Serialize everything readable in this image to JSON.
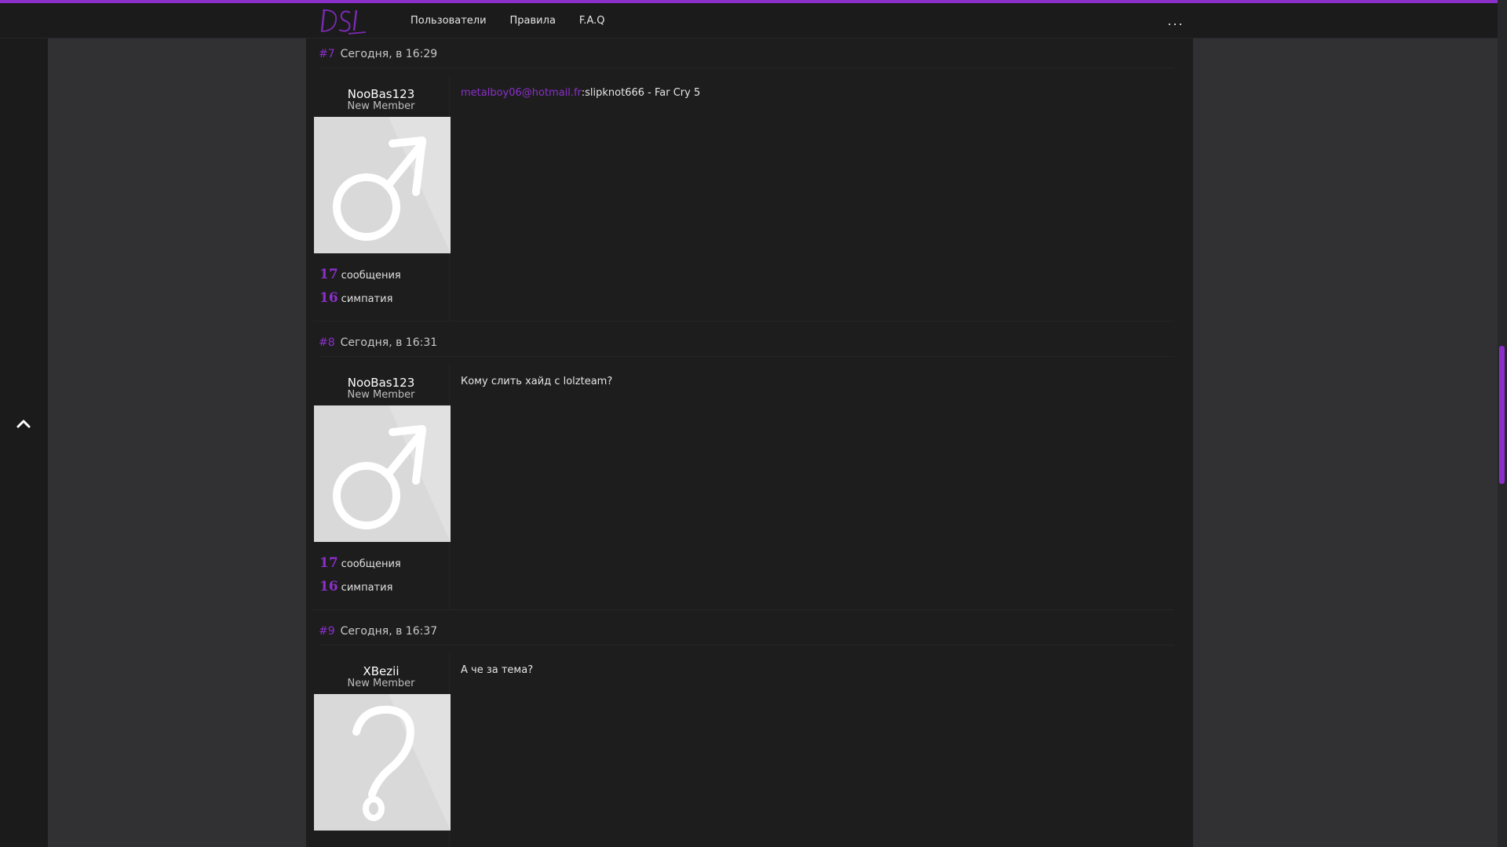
{
  "header": {
    "logo_text": "DSL",
    "nav": [
      "Пользователи",
      "Правила",
      "F.A.Q"
    ],
    "more": "..."
  },
  "colors": {
    "accent": "#8b2fc9",
    "background": "#1d1d1e",
    "side_panel": "#313133"
  },
  "posts": [
    {
      "number": "#7",
      "time": "Сегодня, в 16:29",
      "username": "NooBas123",
      "usertitle": "New Member",
      "avatar_icon": "male-symbol-icon",
      "messages_count": "17",
      "messages_label": "сообщения",
      "likes_count": "16",
      "likes_label": "симпатия",
      "link_text": "metalboy06@hotmail.fr",
      "text": ":slipknot666 - Far Cry 5"
    },
    {
      "number": "#8",
      "time": "Сегодня, в 16:31",
      "username": "NooBas123",
      "usertitle": "New Member",
      "avatar_icon": "male-symbol-icon",
      "messages_count": "17",
      "messages_label": "сообщения",
      "likes_count": "16",
      "likes_label": "симпатия",
      "link_text": "",
      "text": "Кому слить хайд с lolzteam?"
    },
    {
      "number": "#9",
      "time": "Сегодня, в 16:37",
      "username": "XBezii",
      "usertitle": "New Member",
      "avatar_icon": "question-mark-icon",
      "link_text": "",
      "text": "А че за тема?"
    }
  ]
}
